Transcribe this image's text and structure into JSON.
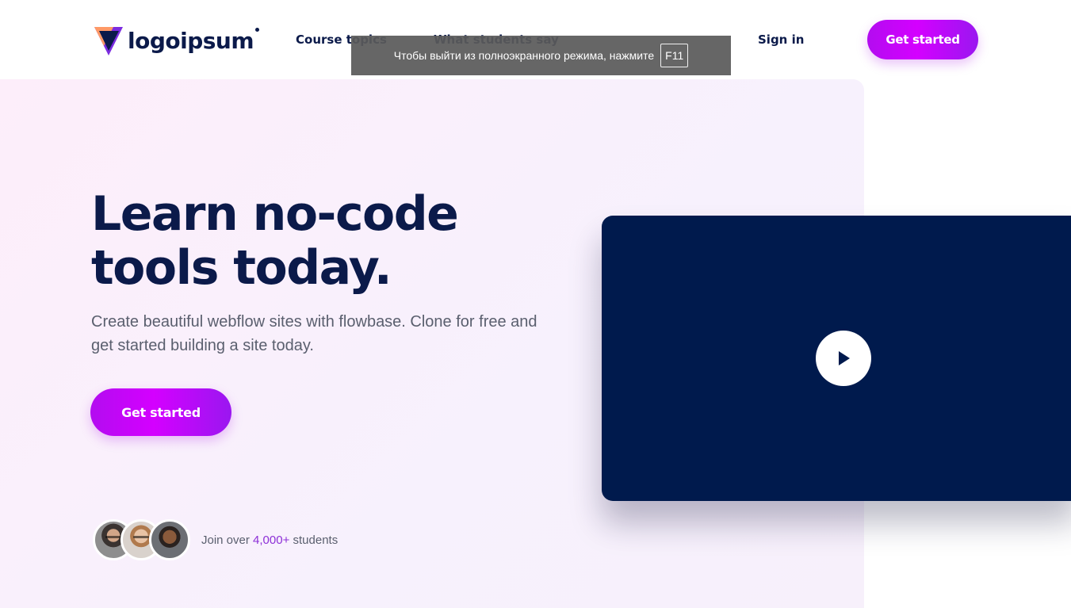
{
  "brand": {
    "name": "logoipsum"
  },
  "nav": {
    "links": [
      "Course topics",
      "What students say"
    ],
    "sign_in": "Sign in",
    "cta": "Get started"
  },
  "fullscreen_notice": {
    "text": "Чтобы выйти из полноэкранного режима, нажмите",
    "key": "F11"
  },
  "hero": {
    "title": "Learn no-code tools today.",
    "subtitle": "Create beautiful webflow sites with flowbase. Clone for free and get started building a site today.",
    "cta": "Get started",
    "social_proof": {
      "prefix": "Join over ",
      "count": "4,000+",
      "suffix": " students"
    }
  },
  "video": {
    "icon": "play-icon"
  },
  "colors": {
    "navy": "#0b1a4a",
    "accent_gradient_start": "#b30cf0",
    "accent_gradient_end": "#9a17f0",
    "hero_bg": "#fdeefa",
    "video_bg": "#001a4d",
    "count_color": "#8d2fd7"
  }
}
